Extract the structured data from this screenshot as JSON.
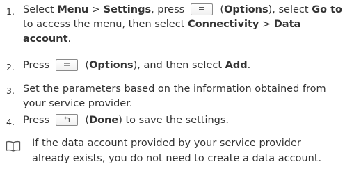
{
  "steps": [
    {
      "num": "1.",
      "s1": "Select ",
      "b1": "Menu",
      "s2": " > ",
      "b2": "Settings",
      "s3": ", press ",
      "s4": " (",
      "b3": "Options",
      "s5": "), select ",
      "b4": "Go to",
      "s6": "to access the menu, then select ",
      "b5": "Connectivity",
      "s7": " > ",
      "b6": "Data",
      "b7": "account",
      "s8": ".",
      "key_icon": "options-key-icon"
    },
    {
      "num": "2.",
      "s1": "Press ",
      "s2": " (",
      "b1": "Options",
      "s3": "), and then select ",
      "b2": "Add",
      "s4": ".",
      "key_icon": "options-key-icon"
    },
    {
      "num": "3.",
      "line1": "Set the parameters based on the information obtained from",
      "line2": "your service provider."
    },
    {
      "num": "4.",
      "s1": "Press ",
      "s2": " (",
      "b1": "Done",
      "s3": ") to save the settings.",
      "key_icon": "done-key-icon"
    }
  ],
  "note": {
    "icon": "book-icon",
    "line1": "If the data account provided by your service provider",
    "line2": "already exists, you do not need to create a data account."
  }
}
